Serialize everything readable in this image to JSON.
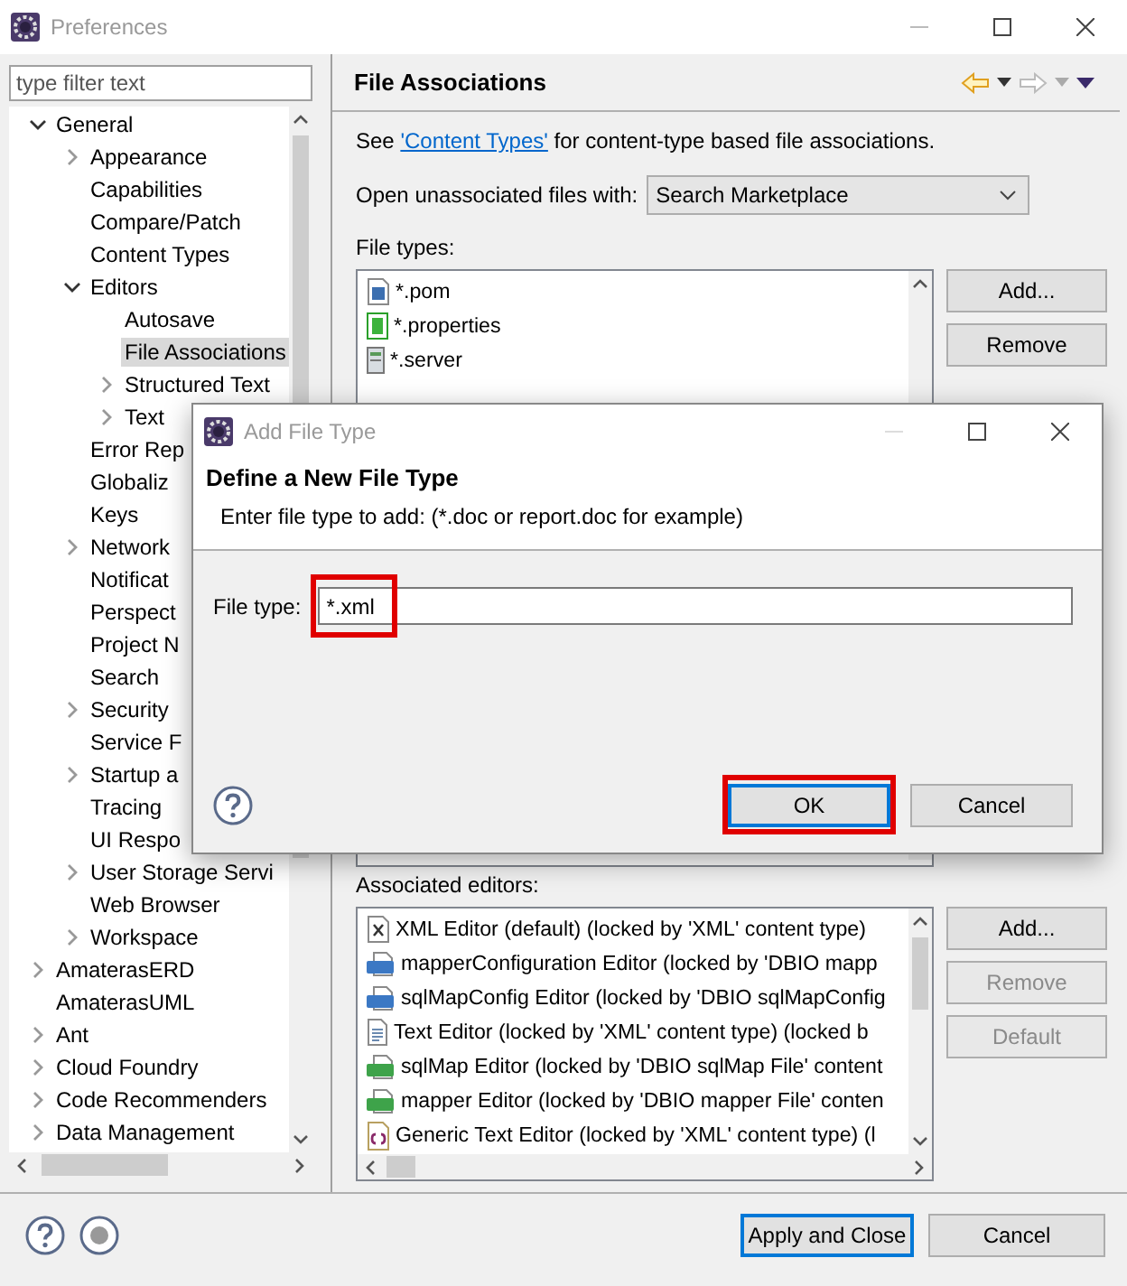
{
  "window": {
    "title": "Preferences"
  },
  "filter": {
    "placeholder": "type filter text"
  },
  "tree": [
    {
      "label": "General",
      "expanded": true,
      "selected": false,
      "children": [
        {
          "label": "Appearance",
          "expanded": false,
          "selected": false
        },
        {
          "label": "Capabilities",
          "selected": false
        },
        {
          "label": "Compare/Patch",
          "selected": false
        },
        {
          "label": "Content Types",
          "selected": false
        },
        {
          "label": "Editors",
          "expanded": true,
          "selected": false,
          "children": [
            {
              "label": "Autosave",
              "selected": false
            },
            {
              "label": "File Associations",
              "selected": true
            },
            {
              "label": "Structured Text",
              "expanded": false,
              "selected": false
            },
            {
              "label": "Text",
              "expanded": false,
              "selected": false
            }
          ]
        },
        {
          "label": "Error Rep",
          "selected": false
        },
        {
          "label": "Globaliz",
          "selected": false
        },
        {
          "label": "Keys",
          "selected": false
        },
        {
          "label": "Network",
          "expanded": false,
          "selected": false
        },
        {
          "label": "Notificat",
          "selected": false
        },
        {
          "label": "Perspect",
          "selected": false
        },
        {
          "label": "Project N",
          "selected": false
        },
        {
          "label": "Search",
          "selected": false
        },
        {
          "label": "Security",
          "expanded": false,
          "selected": false
        },
        {
          "label": "Service F",
          "selected": false
        },
        {
          "label": "Startup a",
          "expanded": false,
          "selected": false
        },
        {
          "label": "Tracing",
          "selected": false
        },
        {
          "label": "UI Respo",
          "selected": false
        },
        {
          "label": "User Storage Servi",
          "expanded": false,
          "selected": false
        },
        {
          "label": "Web Browser",
          "selected": false
        },
        {
          "label": "Workspace",
          "expanded": false,
          "selected": false
        }
      ]
    },
    {
      "label": "AmaterasERD",
      "expanded": false,
      "selected": false
    },
    {
      "label": "AmaterasUML",
      "selected": false
    },
    {
      "label": "Ant",
      "expanded": false,
      "selected": false
    },
    {
      "label": "Cloud Foundry",
      "expanded": false,
      "selected": false
    },
    {
      "label": "Code Recommenders",
      "expanded": false,
      "selected": false
    },
    {
      "label": "Data Management",
      "expanded": false,
      "selected": false
    }
  ],
  "page": {
    "title": "File Associations",
    "intro": {
      "before": "See ",
      "link": "'Content Types'",
      "after": " for content-type based file associations."
    },
    "unassociated": {
      "label": "Open unassociated files with:",
      "value": "Search Marketplace"
    },
    "file_types_label": "File types:",
    "file_types": [
      {
        "name": "*.pom",
        "kind": "maven"
      },
      {
        "name": "*.properties",
        "kind": "properties"
      },
      {
        "name": "*.server",
        "kind": "server"
      }
    ],
    "file_type_buttons": [
      {
        "label": "Add...",
        "disabled": false
      },
      {
        "label": "Remove",
        "disabled": false
      }
    ],
    "editors_label": "Associated editors:",
    "editors": [
      {
        "name": "XML Editor (default) (locked by 'XML' content type)",
        "kind": "xml"
      },
      {
        "name": "mapperConfiguration Editor (locked by 'DBIO mapp",
        "kind": "cfg"
      },
      {
        "name": "sqlMapConfig Editor (locked by 'DBIO sqlMapConfig",
        "kind": "cfg"
      },
      {
        "name": "Text Editor (locked by 'XML' content type) (locked b",
        "kind": "text"
      },
      {
        "name": "sqlMap Editor (locked by 'DBIO sqlMap File' content",
        "kind": "map"
      },
      {
        "name": "mapper Editor (locked by 'DBIO mapper File' conten",
        "kind": "map"
      },
      {
        "name": "Generic Text Editor (locked by 'XML' content type) (l",
        "kind": "generic"
      }
    ],
    "editor_buttons": [
      {
        "label": "Add...",
        "disabled": false
      },
      {
        "label": "Remove",
        "disabled": true
      },
      {
        "label": "Default",
        "disabled": true
      }
    ]
  },
  "dialog": {
    "title": "Add File Type",
    "heading": "Define a New File Type",
    "description": "Enter file type to add: (*.doc or report.doc for example)",
    "field": {
      "label": "File type:",
      "value": "*.xml",
      "highlighted": true
    },
    "buttons": [
      {
        "label": "OK",
        "default": true,
        "highlighted": true
      },
      {
        "label": "Cancel",
        "default": false,
        "highlighted": false
      }
    ]
  },
  "footer": {
    "buttons": [
      {
        "label": "Apply and Close",
        "default": true
      },
      {
        "label": "Cancel",
        "default": false
      }
    ]
  }
}
